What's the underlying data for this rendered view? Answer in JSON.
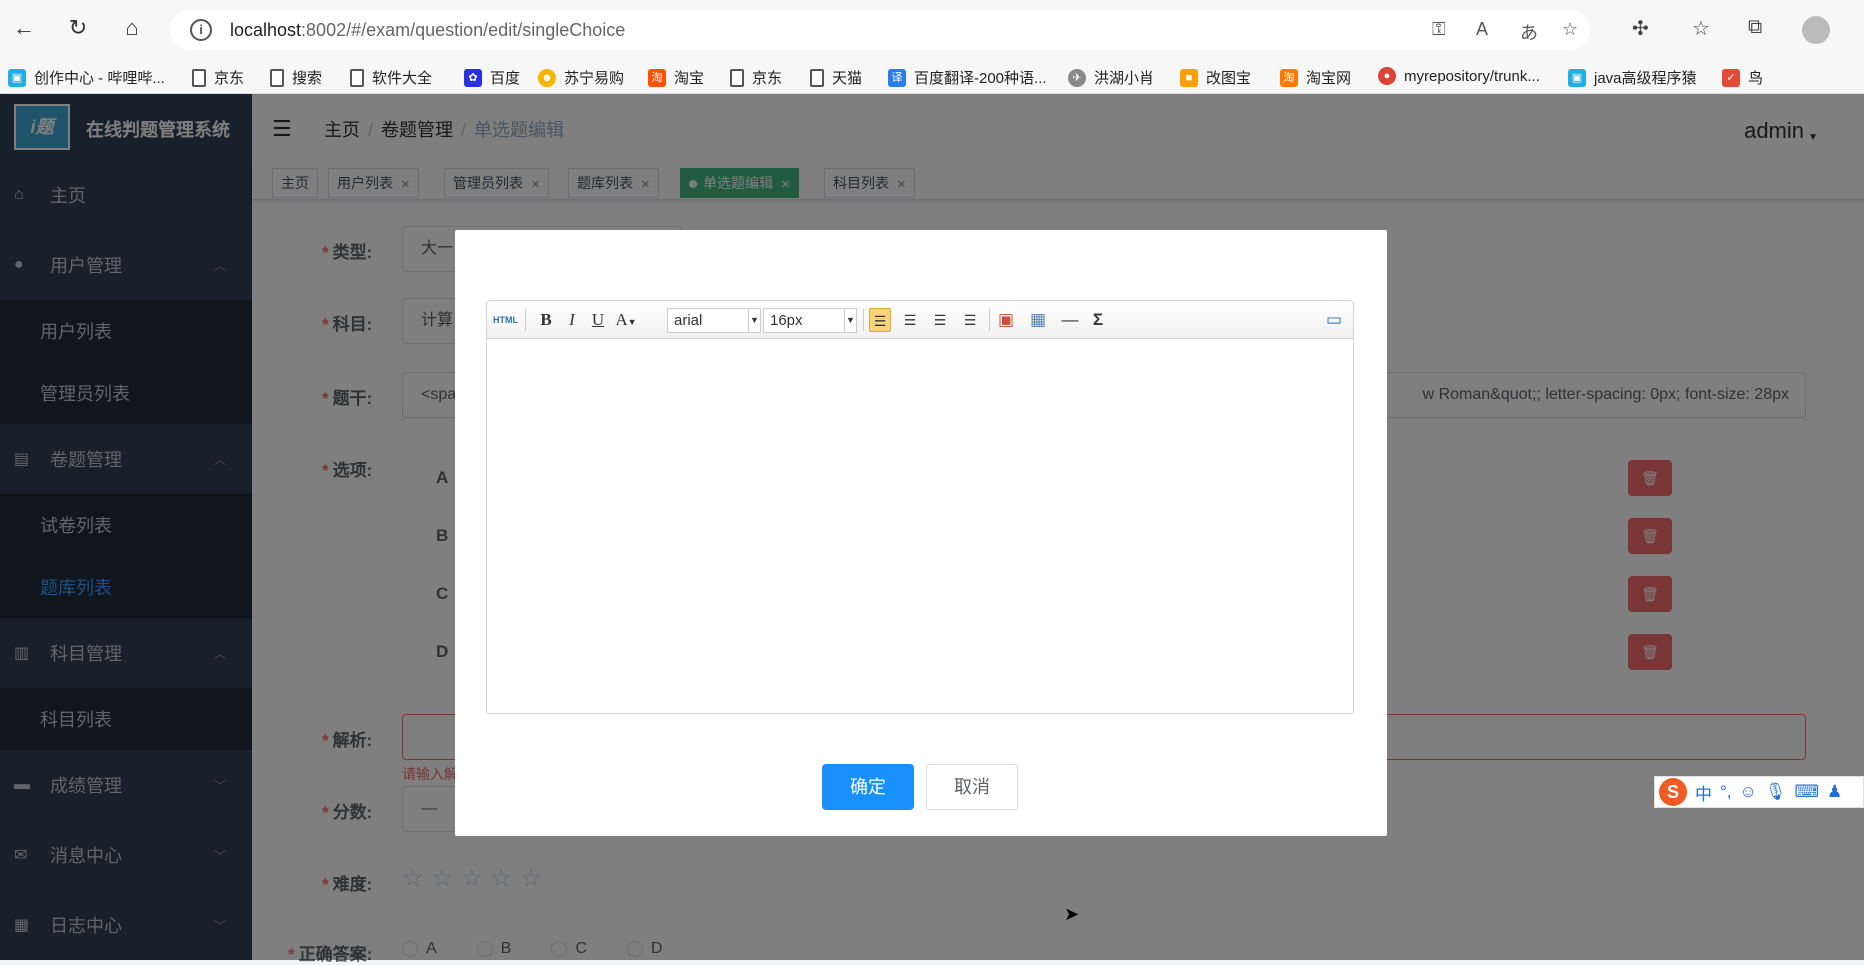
{
  "browser": {
    "url_host": "localhost",
    "url_rest": ":8002/#/exam/question/edit/singleChoice",
    "bookmarks": [
      {
        "label": "创作中心 - 哔哩哔..."
      },
      {
        "label": "京东"
      },
      {
        "label": "搜索"
      },
      {
        "label": "软件大全"
      },
      {
        "label": "百度"
      },
      {
        "label": "苏宁易购"
      },
      {
        "label": "淘宝"
      },
      {
        "label": "京东"
      },
      {
        "label": "天猫"
      },
      {
        "label": "百度翻译-200种语..."
      },
      {
        "label": "洪湖小肖"
      },
      {
        "label": "改图宝"
      },
      {
        "label": "淘宝网"
      },
      {
        "label": "myrepository/trunk..."
      },
      {
        "label": "java高级程序猿"
      },
      {
        "label": "鸟"
      }
    ]
  },
  "sidebar": {
    "logo_text": "i题",
    "title": "在线判题管理系统",
    "items": [
      {
        "label": "主页"
      },
      {
        "label": "用户管理"
      },
      {
        "label": "用户列表"
      },
      {
        "label": "管理员列表"
      },
      {
        "label": "卷题管理"
      },
      {
        "label": "试卷列表"
      },
      {
        "label": "题库列表"
      },
      {
        "label": "科目管理"
      },
      {
        "label": "科目列表"
      },
      {
        "label": "成绩管理"
      },
      {
        "label": "消息中心"
      },
      {
        "label": "日志中心"
      }
    ]
  },
  "header": {
    "breadcrumb": [
      "主页",
      "卷题管理",
      "单选题编辑"
    ],
    "user": "admin"
  },
  "tags": [
    "主页",
    "用户列表",
    "管理员列表",
    "题库列表",
    "单选题编辑",
    "科目列表"
  ],
  "form": {
    "type_label": "类型:",
    "type_value": "大一",
    "subject_label": "科目:",
    "subject_value": "计算",
    "stem_label": "题干:",
    "stem_value_start": "<spa",
    "stem_value_end": "w Roman&quot;; letter-spacing: 0px; font-size: 28px",
    "options_label": "选项:",
    "options": [
      "A",
      "B",
      "C",
      "D"
    ],
    "analysis_label": "解析:",
    "analysis_error": "请输入解",
    "score_label": "分数:",
    "score_value": "—",
    "difficulty_label": "难度:",
    "answer_label": "正确答案:",
    "answers": [
      "A",
      "B",
      "C",
      "D"
    ]
  },
  "dialog": {
    "font_family": "arial",
    "font_size": "16px",
    "confirm": "确定",
    "cancel": "取消"
  },
  "ime": {
    "badge": "S",
    "mode": "中",
    "punct": "°,"
  }
}
